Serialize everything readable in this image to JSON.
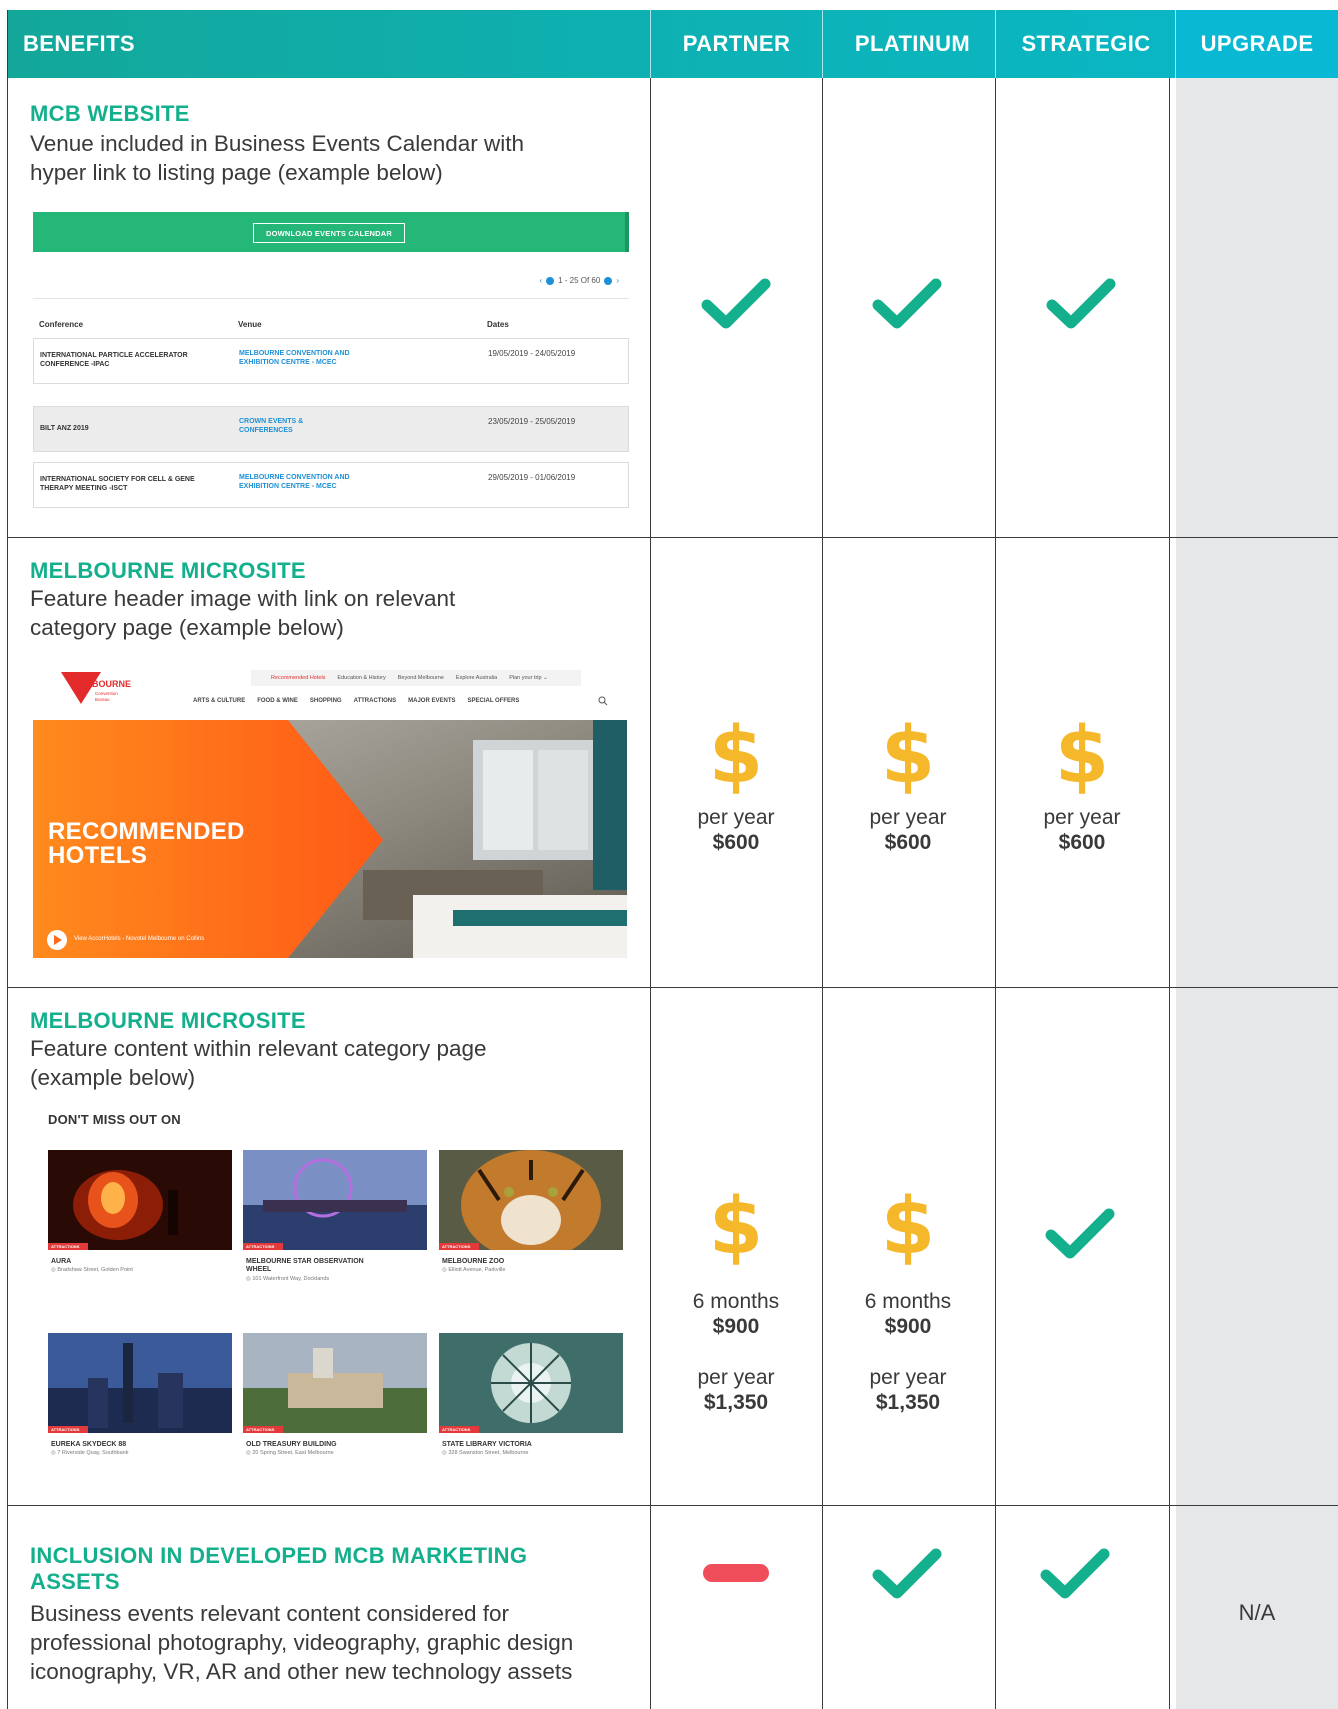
{
  "header": {
    "benefits": "BENEFITS",
    "partner": "PARTNER",
    "platinum": "PLATINUM",
    "strategic": "STRATEGIC",
    "upgrade": "UPGRADE"
  },
  "colors": {
    "teal": "#13a79a",
    "check_green": "#14b08d",
    "dollar_gold": "#f6b82b",
    "dash_red": "#f04e5b",
    "upgrade_grey": "#e6e7e9"
  },
  "rows": [
    {
      "title": "MCB WEBSITE",
      "desc_lines": [
        "Venue included in Business Events Calendar with",
        "hyper link to listing page (example below)"
      ],
      "partner": {
        "icon": "check-icon"
      },
      "platinum": {
        "icon": "check-icon"
      },
      "strategic": {
        "icon": "check-icon"
      }
    },
    {
      "title": "MELBOURNE MICROSITE",
      "desc_lines": [
        "Feature header image with link on relevant",
        "category page (example below)"
      ],
      "partner": {
        "icon": "dollar-icon",
        "period": "per year",
        "price": "$600"
      },
      "platinum": {
        "icon": "dollar-icon",
        "period": "per year",
        "price": "$600"
      },
      "strategic": {
        "icon": "dollar-icon",
        "period": "per year",
        "price": "$600"
      }
    },
    {
      "title": "MELBOURNE MICROSITE",
      "desc_lines": [
        "Feature content within relevant category page",
        "(example below)"
      ],
      "partner": {
        "icon": "dollar-icon",
        "period1": "6 months",
        "price1": "$900",
        "period2": "per year",
        "price2": "$1,350"
      },
      "platinum": {
        "icon": "dollar-icon",
        "period1": "6 months",
        "price1": "$900",
        "period2": "per year",
        "price2": "$1,350"
      },
      "strategic": {
        "icon": "check-icon"
      }
    },
    {
      "title_lines": [
        "INCLUSION IN DEVELOPED MCB MARKETING",
        "ASSETS"
      ],
      "desc_lines": [
        "Business events relevant content considered for",
        "professional photography, videography, graphic design",
        "iconography, VR, AR and other new technology assets"
      ],
      "partner": {
        "icon": "dash-icon"
      },
      "platinum": {
        "icon": "check-icon"
      },
      "strategic": {
        "icon": "check-icon"
      },
      "upgrade": "N/A"
    }
  ],
  "calendar_example": {
    "button": "DOWNLOAD EVENTS CALENDAR",
    "pager": "1 - 25  Of  60",
    "col_conference": "Conference",
    "col_venue": "Venue",
    "col_dates": "Dates",
    "events": [
      {
        "conf1": "INTERNATIONAL PARTICLE ACCELERATOR",
        "conf2": "CONFERENCE -IPAC",
        "venue1": "MELBOURNE CONVENTION AND",
        "venue2": "EXHIBITION CENTRE - MCEC",
        "dates": "19/05/2019 - 24/05/2019"
      },
      {
        "conf1": "BILT ANZ 2019",
        "conf2": "",
        "venue1": "CROWN EVENTS &",
        "venue2": "CONFERENCES",
        "dates": "23/05/2019 - 25/05/2019"
      },
      {
        "conf1": "INTERNATIONAL SOCIETY FOR CELL & GENE",
        "conf2": "THERAPY MEETING -ISCT",
        "venue1": "MELBOURNE CONVENTION AND",
        "venue2": "EXHIBITION CENTRE - MCEC",
        "dates": "29/05/2019 - 01/06/2019"
      }
    ]
  },
  "microsite_example": {
    "logo1": "MELBOURNE",
    "logo2": "Convention",
    "logo3": "Bureau",
    "topnav": [
      "Recommended Hotels",
      "Education & History",
      "Beyond Melbourne",
      "Explore Australia",
      "Plan your trip ⌄"
    ],
    "mainnav": [
      "ARTS & CULTURE",
      "FOOD & WINE",
      "SHOPPING",
      "ATTRACTIONS",
      "MAJOR EVENTS",
      "SPECIAL OFFERS"
    ],
    "hero_line1": "RECOMMENDED",
    "hero_line2": "HOTELS",
    "view_link": "View AccorHotels - Novotel Melbourne on Collins"
  },
  "content_example": {
    "heading": "DON'T MISS OUT ON",
    "tag": "ATTRACTIONS",
    "tiles": [
      {
        "name1": "AURA",
        "name2": "",
        "addr": "◎ Bradshaw Street, Golden Point"
      },
      {
        "name1": "MELBOURNE STAR OBSERVATION",
        "name2": "WHEEL",
        "addr": "◎ 101 Waterfront Way, Docklands"
      },
      {
        "name1": "MELBOURNE ZOO",
        "name2": "",
        "addr": "◎ Elliott Avenue, Parkville"
      },
      {
        "name1": "EUREKA SKYDECK 88",
        "name2": "",
        "addr": "◎ 7 Riverside Quay, Southbank"
      },
      {
        "name1": "OLD TREASURY BUILDING",
        "name2": "",
        "addr": "◎ 20 Spring Street, East Melbourne"
      },
      {
        "name1": "STATE LIBRARY VICTORIA",
        "name2": "",
        "addr": "◎ 328 Swanston Street, Melbourne"
      }
    ]
  }
}
